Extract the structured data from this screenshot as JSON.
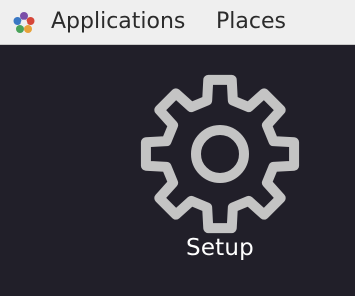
{
  "top_panel": {
    "logo_icon": "distro-logo-icon",
    "menus": [
      {
        "label": "Applications"
      },
      {
        "label": "Places"
      }
    ]
  },
  "desktop": {
    "background_color": "#211f29",
    "icons": [
      {
        "label": "Setup",
        "icon": "gear-icon",
        "icon_color": "#c4c4c4"
      }
    ]
  }
}
